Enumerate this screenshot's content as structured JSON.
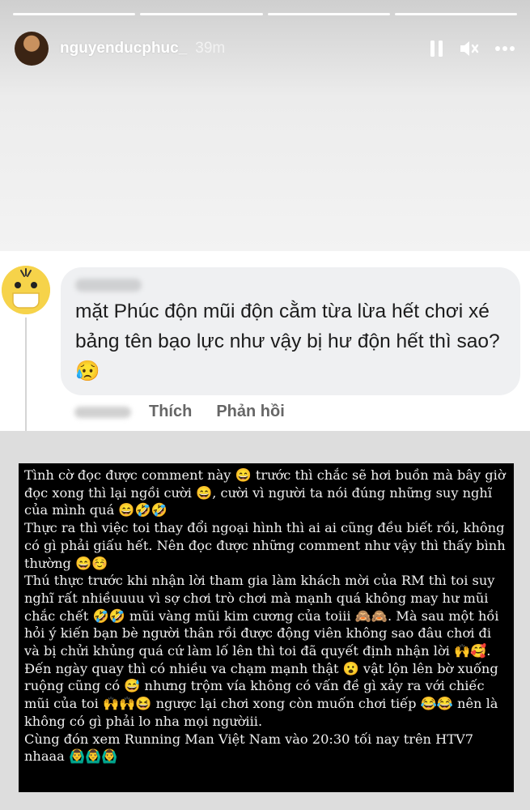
{
  "story": {
    "username": "nguyenducphuc_",
    "time_ago": "39m",
    "icons": {
      "pause": "pause-icon",
      "mute": "speaker-muted-icon",
      "more": "more-icon"
    }
  },
  "comment": {
    "text": "mặt Phúc độn mũi độn cằm từa lừa hết chơi xé bảng tên bạo lực như vậy bị hư độn hết thì sao? 😥",
    "like_label": "Thích",
    "reply_label": "Phản hồi"
  },
  "caption": {
    "text": "Tình cờ đọc được comment này 😄 trước thì chắc sẽ hơi buồn mà bây giờ đọc xong thì lại ngồi cười 😄, cười vì người ta nói đúng những suy nghĩ của mình quá 😄🤣🤣\nThực ra thì việc toi thay đổi ngoại hình thì ai ai cũng đều biết rồi, không có gì phải giấu hết. Nên đọc được những comment như vậy thì thấy bình thường 😄☺️\nThú thực trước khi nhận lời tham gia làm khách mời của RM thì toi suy nghĩ rất nhiềuuuu vì sợ chơi trò chơi mà mạnh quá không may hư mũi chắc chết 🤣🤣 mũi vàng mũi kim cương của toiii 🙈🙈. Mà sau một hồi hỏi ý kiến bạn bè người thân rồi được động viên không sao đâu chơi đi và bị chửi khủng quá cứ làm lố lên thì toi đã quyết định nhận lời 🙌🥰. Đến ngày quay thì có nhiều va chạm mạnh thật 😮 vật lộn lên bờ xuống ruộng cũng có 😅 nhưng trộm vía không có vấn đề gì xảy ra với chiếc mũi của toi 🙌🙌😆 ngược lại chơi xong còn muốn chơi tiếp 😂😂 nên là không có gì phải lo nha mọi ngườiii.\nCùng đón xem Running Man Việt Nam vào 20:30 tối nay trên HTV7 nhaaa 🙆‍♂️🙆‍♂️🙆‍♂️"
  }
}
